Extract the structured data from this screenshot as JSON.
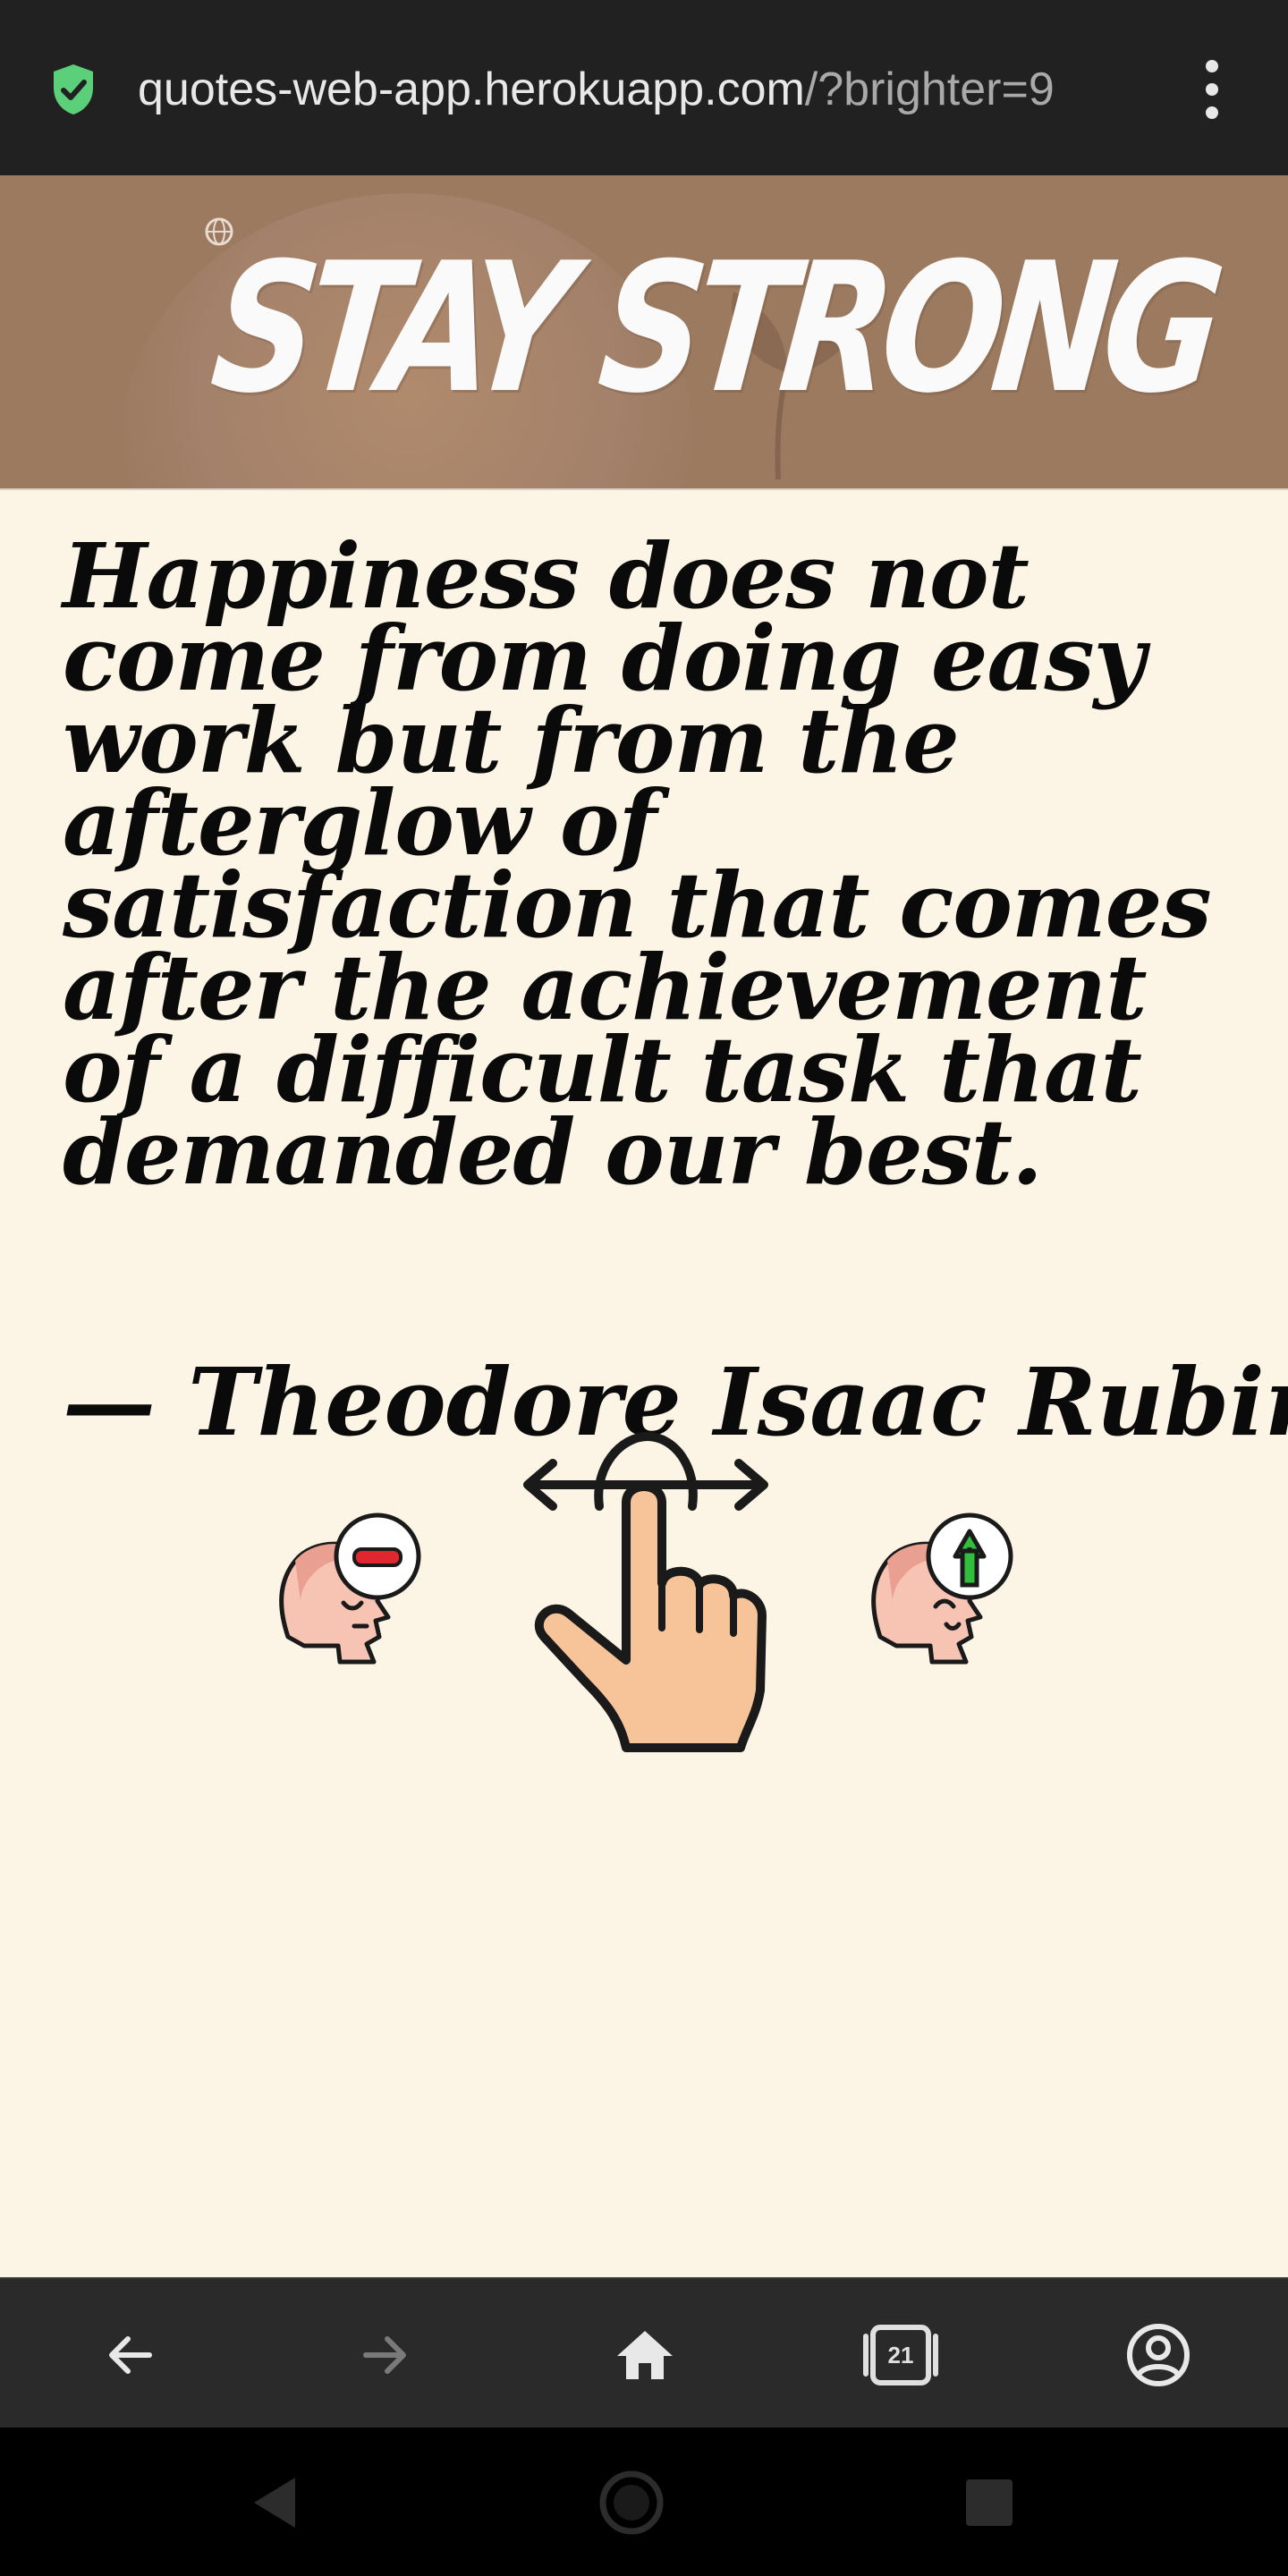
{
  "browser": {
    "url_host": "quotes-web-app.herokuapp.com",
    "url_path": "/?brighter=9",
    "tabs_count": "21",
    "icons": [
      "secure-shield-icon",
      "more-menu-icon",
      "back-arrow-icon",
      "forward-arrow-icon",
      "home-icon",
      "tabs-icon",
      "account-icon"
    ]
  },
  "hero": {
    "title": "STAY STRONG"
  },
  "quote": {
    "text": "Happiness does not come from doing easy work but from the afterglow of satisfaction that comes after the achievement of a difficult task that demanded our best.",
    "author": "— Theodore Isaac Rubin"
  },
  "gestures": {
    "icons": [
      "dimmer-head-icon",
      "swipe-hand-icon",
      "brighter-head-icon"
    ]
  },
  "colors": {
    "address_bar": "#212121",
    "hero_bg": "#9c7a60",
    "page_bg": "#fcf4e4",
    "toolbar_bg": "#2a2a2a",
    "secure_green": "#5ccf7a"
  },
  "android_nav": {
    "icons": [
      "nav-back-icon",
      "nav-home-icon",
      "nav-recents-icon"
    ]
  }
}
